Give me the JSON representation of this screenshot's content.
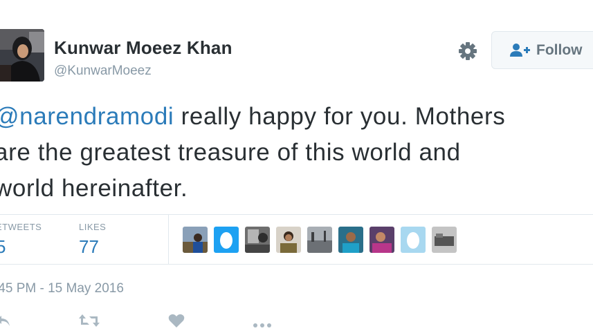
{
  "author": {
    "name": "Kunwar Moeez Khan",
    "handle": "@KunwarMoeez"
  },
  "header": {
    "settings_icon": "gear-icon",
    "follow_icon": "add-user-icon",
    "follow_label": "Follow"
  },
  "tweet": {
    "mention": "@narendramodi",
    "text_line1_rest": " really happy for you. Mothers",
    "text_line2": "are the greatest treasure of this world and",
    "text_line3": "world hereinafter."
  },
  "stats": {
    "retweets_label": "ETWEETS",
    "retweets_value": "5",
    "likes_label": "LIKES",
    "likes_value": "77"
  },
  "likers": [
    "avatar-1",
    "avatar-2-default-egg",
    "avatar-3",
    "avatar-4",
    "avatar-5",
    "avatar-6",
    "avatar-7",
    "avatar-8-default-egg",
    "avatar-9"
  ],
  "timestamp": ":45 PM - 15 May 2016",
  "actions": [
    "reply-icon",
    "retweet-icon",
    "like-icon",
    "more-icon"
  ],
  "colors": {
    "link": "#2b7bb9",
    "text": "#292f33",
    "muted": "#8899a6",
    "border": "#e1e8ed"
  }
}
